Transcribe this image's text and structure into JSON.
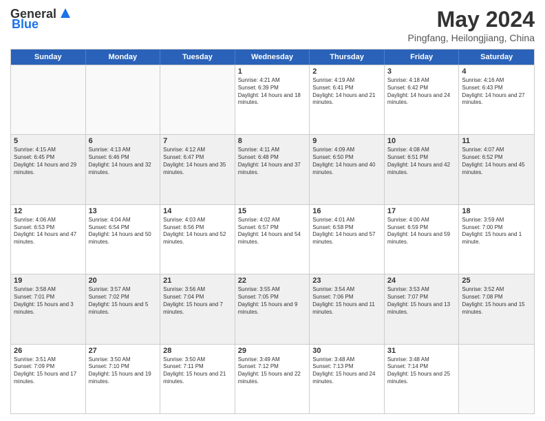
{
  "header": {
    "logo_general": "General",
    "logo_blue": "Blue",
    "main_title": "May 2024",
    "subtitle": "Pingfang, Heilongjiang, China"
  },
  "days_of_week": [
    "Sunday",
    "Monday",
    "Tuesday",
    "Wednesday",
    "Thursday",
    "Friday",
    "Saturday"
  ],
  "weeks": [
    [
      {
        "day": "",
        "empty": true
      },
      {
        "day": "",
        "empty": true
      },
      {
        "day": "",
        "empty": true
      },
      {
        "day": "1",
        "sunrise": "Sunrise: 4:21 AM",
        "sunset": "Sunset: 6:39 PM",
        "daylight": "Daylight: 14 hours and 18 minutes."
      },
      {
        "day": "2",
        "sunrise": "Sunrise: 4:19 AM",
        "sunset": "Sunset: 6:41 PM",
        "daylight": "Daylight: 14 hours and 21 minutes."
      },
      {
        "day": "3",
        "sunrise": "Sunrise: 4:18 AM",
        "sunset": "Sunset: 6:42 PM",
        "daylight": "Daylight: 14 hours and 24 minutes."
      },
      {
        "day": "4",
        "sunrise": "Sunrise: 4:16 AM",
        "sunset": "Sunset: 6:43 PM",
        "daylight": "Daylight: 14 hours and 27 minutes."
      }
    ],
    [
      {
        "day": "5",
        "sunrise": "Sunrise: 4:15 AM",
        "sunset": "Sunset: 6:45 PM",
        "daylight": "Daylight: 14 hours and 29 minutes."
      },
      {
        "day": "6",
        "sunrise": "Sunrise: 4:13 AM",
        "sunset": "Sunset: 6:46 PM",
        "daylight": "Daylight: 14 hours and 32 minutes."
      },
      {
        "day": "7",
        "sunrise": "Sunrise: 4:12 AM",
        "sunset": "Sunset: 6:47 PM",
        "daylight": "Daylight: 14 hours and 35 minutes."
      },
      {
        "day": "8",
        "sunrise": "Sunrise: 4:11 AM",
        "sunset": "Sunset: 6:48 PM",
        "daylight": "Daylight: 14 hours and 37 minutes."
      },
      {
        "day": "9",
        "sunrise": "Sunrise: 4:09 AM",
        "sunset": "Sunset: 6:50 PM",
        "daylight": "Daylight: 14 hours and 40 minutes."
      },
      {
        "day": "10",
        "sunrise": "Sunrise: 4:08 AM",
        "sunset": "Sunset: 6:51 PM",
        "daylight": "Daylight: 14 hours and 42 minutes."
      },
      {
        "day": "11",
        "sunrise": "Sunrise: 4:07 AM",
        "sunset": "Sunset: 6:52 PM",
        "daylight": "Daylight: 14 hours and 45 minutes."
      }
    ],
    [
      {
        "day": "12",
        "sunrise": "Sunrise: 4:06 AM",
        "sunset": "Sunset: 6:53 PM",
        "daylight": "Daylight: 14 hours and 47 minutes."
      },
      {
        "day": "13",
        "sunrise": "Sunrise: 4:04 AM",
        "sunset": "Sunset: 6:54 PM",
        "daylight": "Daylight: 14 hours and 50 minutes."
      },
      {
        "day": "14",
        "sunrise": "Sunrise: 4:03 AM",
        "sunset": "Sunset: 6:56 PM",
        "daylight": "Daylight: 14 hours and 52 minutes."
      },
      {
        "day": "15",
        "sunrise": "Sunrise: 4:02 AM",
        "sunset": "Sunset: 6:57 PM",
        "daylight": "Daylight: 14 hours and 54 minutes."
      },
      {
        "day": "16",
        "sunrise": "Sunrise: 4:01 AM",
        "sunset": "Sunset: 6:58 PM",
        "daylight": "Daylight: 14 hours and 57 minutes."
      },
      {
        "day": "17",
        "sunrise": "Sunrise: 4:00 AM",
        "sunset": "Sunset: 6:59 PM",
        "daylight": "Daylight: 14 hours and 59 minutes."
      },
      {
        "day": "18",
        "sunrise": "Sunrise: 3:59 AM",
        "sunset": "Sunset: 7:00 PM",
        "daylight": "Daylight: 15 hours and 1 minute."
      }
    ],
    [
      {
        "day": "19",
        "sunrise": "Sunrise: 3:58 AM",
        "sunset": "Sunset: 7:01 PM",
        "daylight": "Daylight: 15 hours and 3 minutes."
      },
      {
        "day": "20",
        "sunrise": "Sunrise: 3:57 AM",
        "sunset": "Sunset: 7:02 PM",
        "daylight": "Daylight: 15 hours and 5 minutes."
      },
      {
        "day": "21",
        "sunrise": "Sunrise: 3:56 AM",
        "sunset": "Sunset: 7:04 PM",
        "daylight": "Daylight: 15 hours and 7 minutes."
      },
      {
        "day": "22",
        "sunrise": "Sunrise: 3:55 AM",
        "sunset": "Sunset: 7:05 PM",
        "daylight": "Daylight: 15 hours and 9 minutes."
      },
      {
        "day": "23",
        "sunrise": "Sunrise: 3:54 AM",
        "sunset": "Sunset: 7:06 PM",
        "daylight": "Daylight: 15 hours and 11 minutes."
      },
      {
        "day": "24",
        "sunrise": "Sunrise: 3:53 AM",
        "sunset": "Sunset: 7:07 PM",
        "daylight": "Daylight: 15 hours and 13 minutes."
      },
      {
        "day": "25",
        "sunrise": "Sunrise: 3:52 AM",
        "sunset": "Sunset: 7:08 PM",
        "daylight": "Daylight: 15 hours and 15 minutes."
      }
    ],
    [
      {
        "day": "26",
        "sunrise": "Sunrise: 3:51 AM",
        "sunset": "Sunset: 7:09 PM",
        "daylight": "Daylight: 15 hours and 17 minutes."
      },
      {
        "day": "27",
        "sunrise": "Sunrise: 3:50 AM",
        "sunset": "Sunset: 7:10 PM",
        "daylight": "Daylight: 15 hours and 19 minutes."
      },
      {
        "day": "28",
        "sunrise": "Sunrise: 3:50 AM",
        "sunset": "Sunset: 7:11 PM",
        "daylight": "Daylight: 15 hours and 21 minutes."
      },
      {
        "day": "29",
        "sunrise": "Sunrise: 3:49 AM",
        "sunset": "Sunset: 7:12 PM",
        "daylight": "Daylight: 15 hours and 22 minutes."
      },
      {
        "day": "30",
        "sunrise": "Sunrise: 3:48 AM",
        "sunset": "Sunset: 7:13 PM",
        "daylight": "Daylight: 15 hours and 24 minutes."
      },
      {
        "day": "31",
        "sunrise": "Sunrise: 3:48 AM",
        "sunset": "Sunset: 7:14 PM",
        "daylight": "Daylight: 15 hours and 25 minutes."
      },
      {
        "day": "",
        "empty": true
      }
    ]
  ]
}
